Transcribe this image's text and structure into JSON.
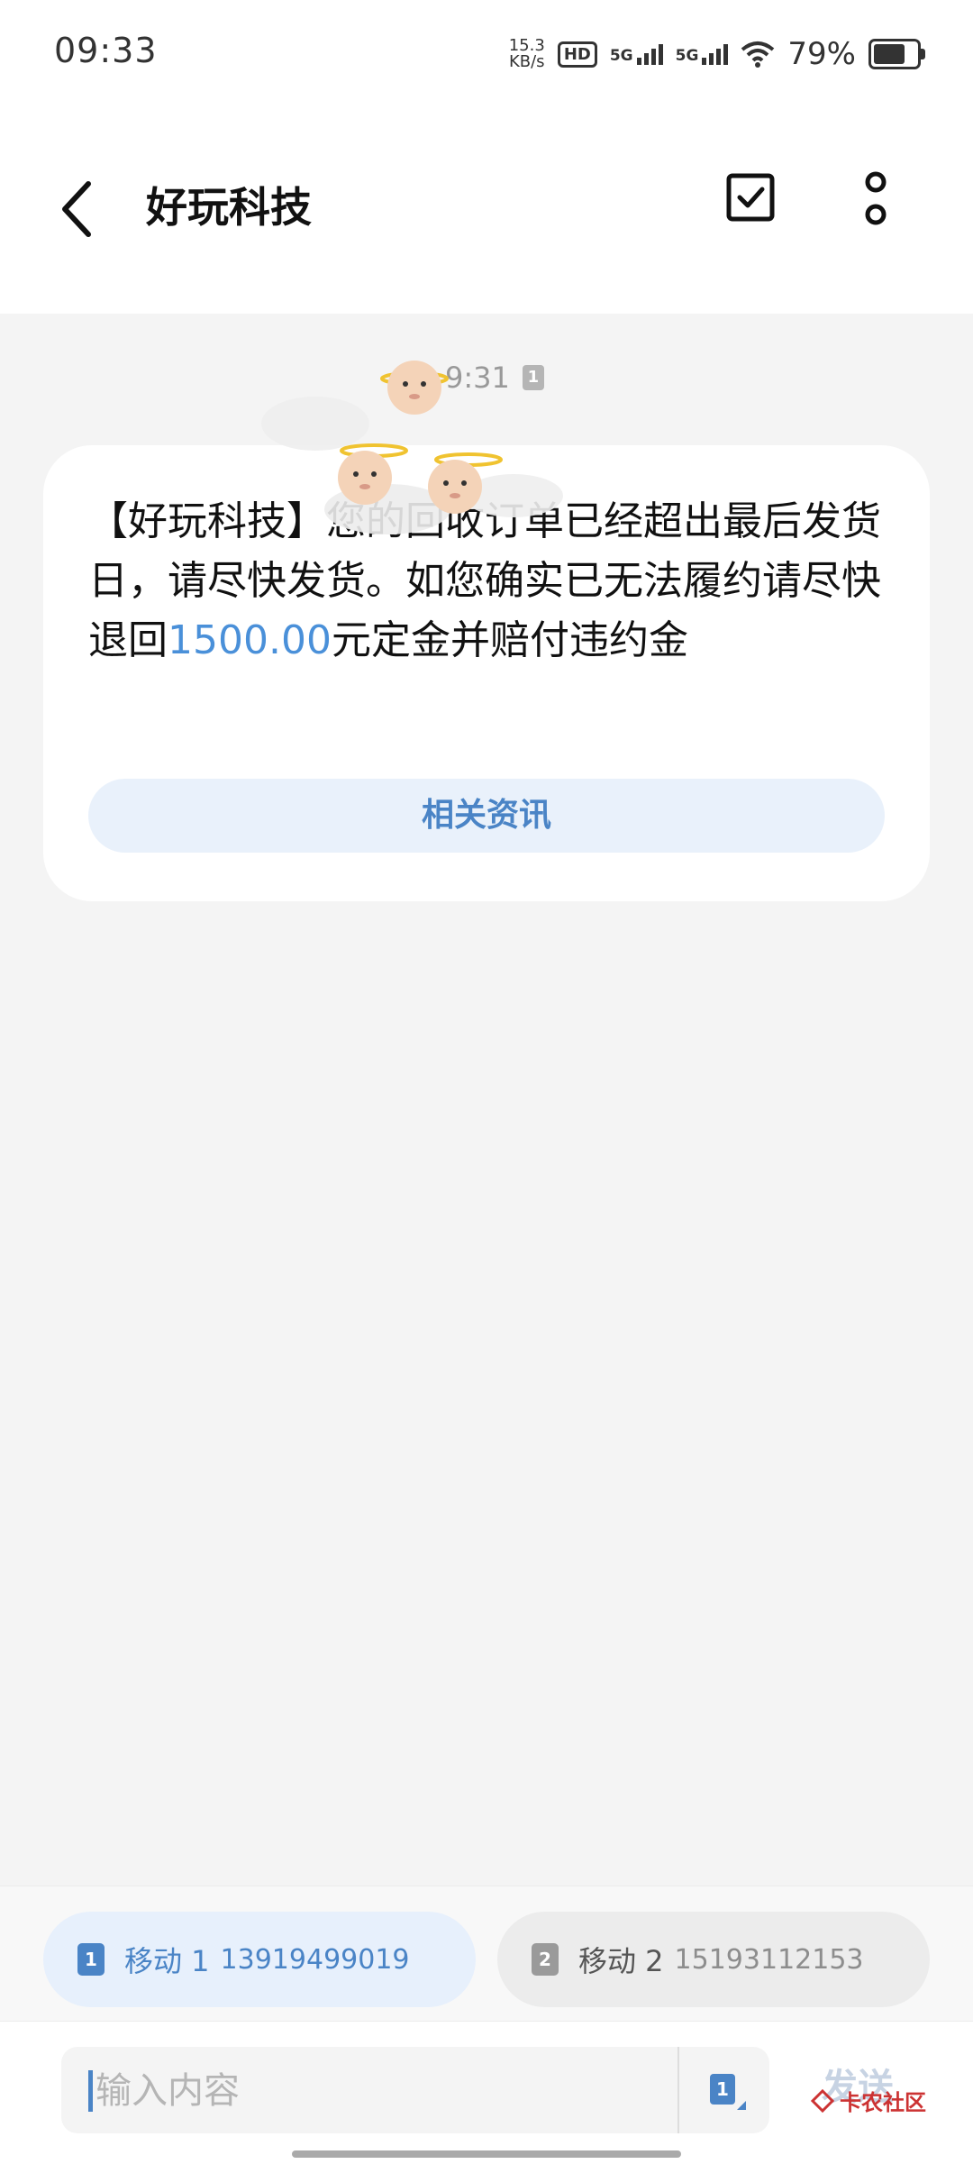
{
  "status": {
    "time": "09:33",
    "net_speed_value": "15.3",
    "net_speed_unit": "KB/s",
    "hd_label": "HD",
    "sim1_network": "5G",
    "sim2_network": "5G",
    "battery_percent": "79%"
  },
  "header": {
    "title": "好玩科技"
  },
  "conversation": {
    "timestamp": "9:31",
    "sim_indicator": "1",
    "message": {
      "text_before": "【好玩科技】您的回收订单已经超出最后发货日，请尽快发货。如您确实已无法履约请尽快退回",
      "amount": "1500.00",
      "text_after": "元定金并赔付违约金"
    },
    "related_button": "相关资讯"
  },
  "sim_choices": [
    {
      "badge": "1",
      "label": "移动 1",
      "number": "13919499019"
    },
    {
      "badge": "2",
      "label": "移动 2",
      "number": "15193112153"
    }
  ],
  "composer": {
    "placeholder": "输入内容",
    "sim_selected": "1",
    "send_label": "发送"
  },
  "watermark": "卡农社区",
  "colors": {
    "accent": "#4a84c6",
    "amount": "#4a90d9",
    "background": "#f4f4f4"
  }
}
